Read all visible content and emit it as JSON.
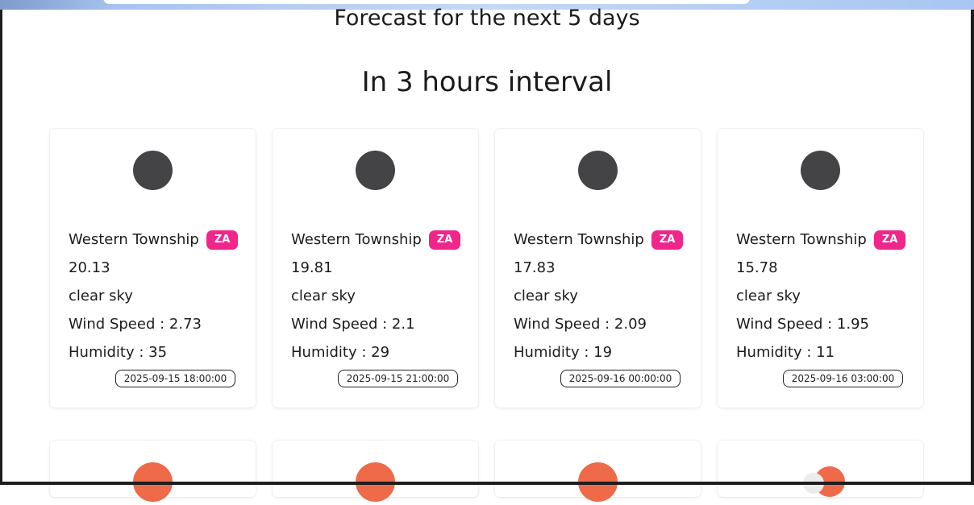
{
  "page": {
    "title_main": "Forecast for the next 5 days",
    "title_sub": "In 3 hours interval"
  },
  "forecast": [
    {
      "city": "Western Township",
      "country": "ZA",
      "temp": "20.13",
      "description": "clear sky",
      "wind": "Wind Speed : 2.73",
      "humidity": "Humidity : 35",
      "datetime": "2025-09-15 18:00:00",
      "icon": "night-clear-icon"
    },
    {
      "city": "Western Township",
      "country": "ZA",
      "temp": "19.81",
      "description": "clear sky",
      "wind": "Wind Speed : 2.1",
      "humidity": "Humidity : 29",
      "datetime": "2025-09-15 21:00:00",
      "icon": "night-clear-icon"
    },
    {
      "city": "Western Township",
      "country": "ZA",
      "temp": "17.83",
      "description": "clear sky",
      "wind": "Wind Speed : 2.09",
      "humidity": "Humidity : 19",
      "datetime": "2025-09-16 00:00:00",
      "icon": "night-clear-icon"
    },
    {
      "city": "Western Township",
      "country": "ZA",
      "temp": "15.78",
      "description": "clear sky",
      "wind": "Wind Speed : 1.95",
      "humidity": "Humidity : 11",
      "datetime": "2025-09-16 03:00:00",
      "icon": "night-clear-icon"
    }
  ],
  "next_row_icons": [
    "sun-icon",
    "sun-icon",
    "sun-icon",
    "partly-cloudy-icon"
  ],
  "colors": {
    "badge": "#f0268a",
    "night_icon": "#444446",
    "sun_icon": "#ee6a48"
  }
}
